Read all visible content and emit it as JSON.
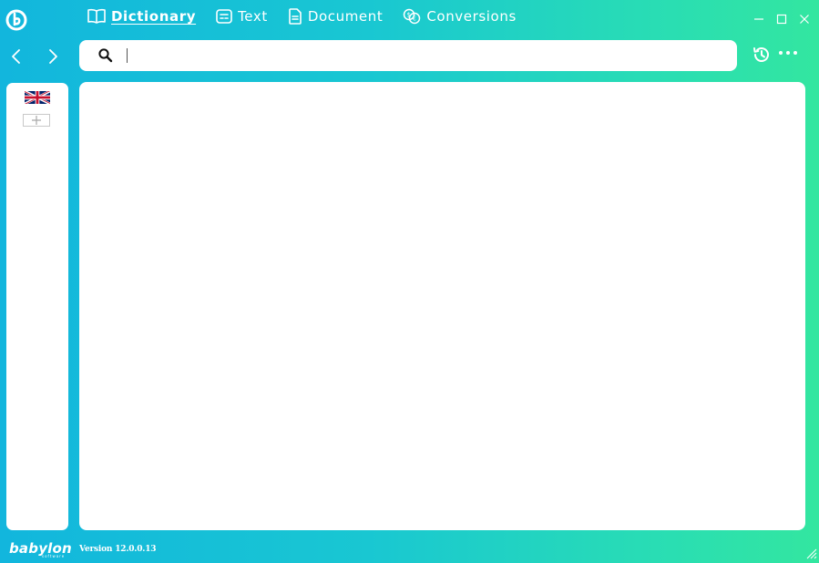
{
  "app": {
    "logo_icon": "babylon-logo-icon"
  },
  "tabs": [
    {
      "label": "Dictionary",
      "icon": "book-icon",
      "active": true
    },
    {
      "label": "Text",
      "icon": "text-icon",
      "active": false
    },
    {
      "label": "Document",
      "icon": "document-icon",
      "active": false
    },
    {
      "label": "Conversions",
      "icon": "currency-conversion-icon",
      "active": false
    }
  ],
  "search": {
    "value": "",
    "placeholder": ""
  },
  "sidebar": {
    "languages": [
      {
        "icon": "uk-flag-icon"
      }
    ],
    "add_icon": "add-language-icon"
  },
  "footer": {
    "brand": "babylon",
    "brand_sub": "software",
    "version": "Version 12.0.0.13"
  },
  "colors": {
    "gradient_start": "#12b6dd",
    "gradient_end": "#33e6a0",
    "panel": "#ffffff"
  }
}
